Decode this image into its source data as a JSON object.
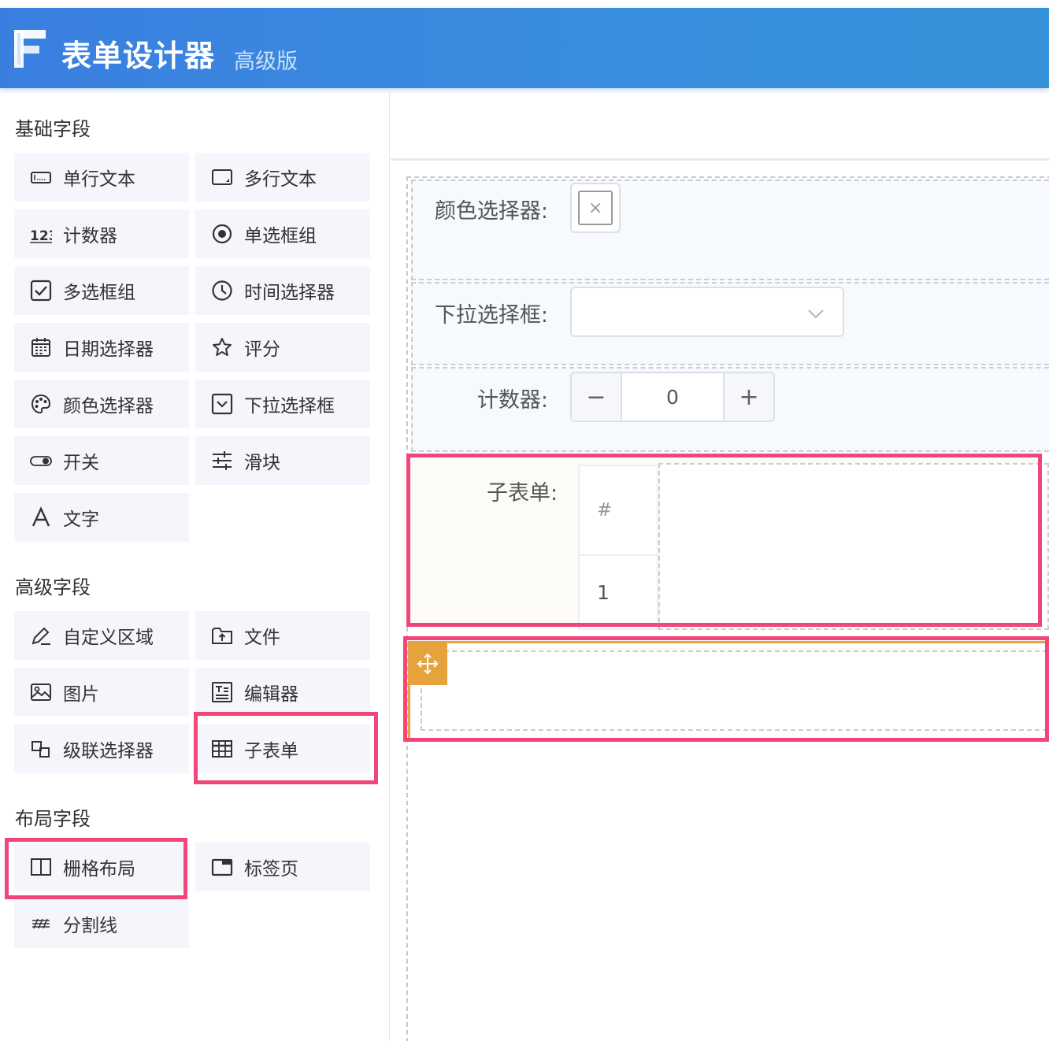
{
  "header": {
    "title": "表单设计器",
    "badge": "高级版"
  },
  "sidebar": {
    "sections": [
      {
        "title": "基础字段",
        "items": [
          {
            "label": "单行文本",
            "icon": "input-icon"
          },
          {
            "label": "多行文本",
            "icon": "textarea-icon"
          },
          {
            "label": "计数器",
            "icon": "number-123-icon"
          },
          {
            "label": "单选框组",
            "icon": "radio-icon"
          },
          {
            "label": "多选框组",
            "icon": "checkbox-icon"
          },
          {
            "label": "时间选择器",
            "icon": "clock-icon"
          },
          {
            "label": "日期选择器",
            "icon": "calendar-icon"
          },
          {
            "label": "评分",
            "icon": "star-icon"
          },
          {
            "label": "颜色选择器",
            "icon": "palette-icon"
          },
          {
            "label": "下拉选择框",
            "icon": "select-icon"
          },
          {
            "label": "开关",
            "icon": "switch-icon"
          },
          {
            "label": "滑块",
            "icon": "slider-icon"
          },
          {
            "label": "文字",
            "icon": "text-icon"
          }
        ]
      },
      {
        "title": "高级字段",
        "items": [
          {
            "label": "自定义区域",
            "icon": "edit-icon"
          },
          {
            "label": "文件",
            "icon": "folder-upload-icon"
          },
          {
            "label": "图片",
            "icon": "image-icon"
          },
          {
            "label": "编辑器",
            "icon": "editor-icon"
          },
          {
            "label": "级联选择器",
            "icon": "cascader-icon"
          },
          {
            "label": "子表单",
            "icon": "table-icon"
          }
        ]
      },
      {
        "title": "布局字段",
        "items": [
          {
            "label": "栅格布局",
            "icon": "grid-icon"
          },
          {
            "label": "标签页",
            "icon": "tabs-icon"
          },
          {
            "label": "分割线",
            "icon": "divider-icon"
          }
        ]
      }
    ]
  },
  "canvas": {
    "color_picker": {
      "label": "颜色选择器:",
      "empty_symbol": "×"
    },
    "select": {
      "label": "下拉选择框:",
      "value": ""
    },
    "counter": {
      "label": "计数器:",
      "minus": "−",
      "value": "0",
      "plus": "+"
    },
    "subform": {
      "label": "子表单:",
      "header": "#",
      "rows": [
        "1"
      ]
    }
  },
  "colors": {
    "header_start": "#3a7fe0",
    "header_end": "#3592d8",
    "highlight": "#f0467a",
    "selected": "#e6a23c",
    "button_bg": "#f4f6fc"
  }
}
